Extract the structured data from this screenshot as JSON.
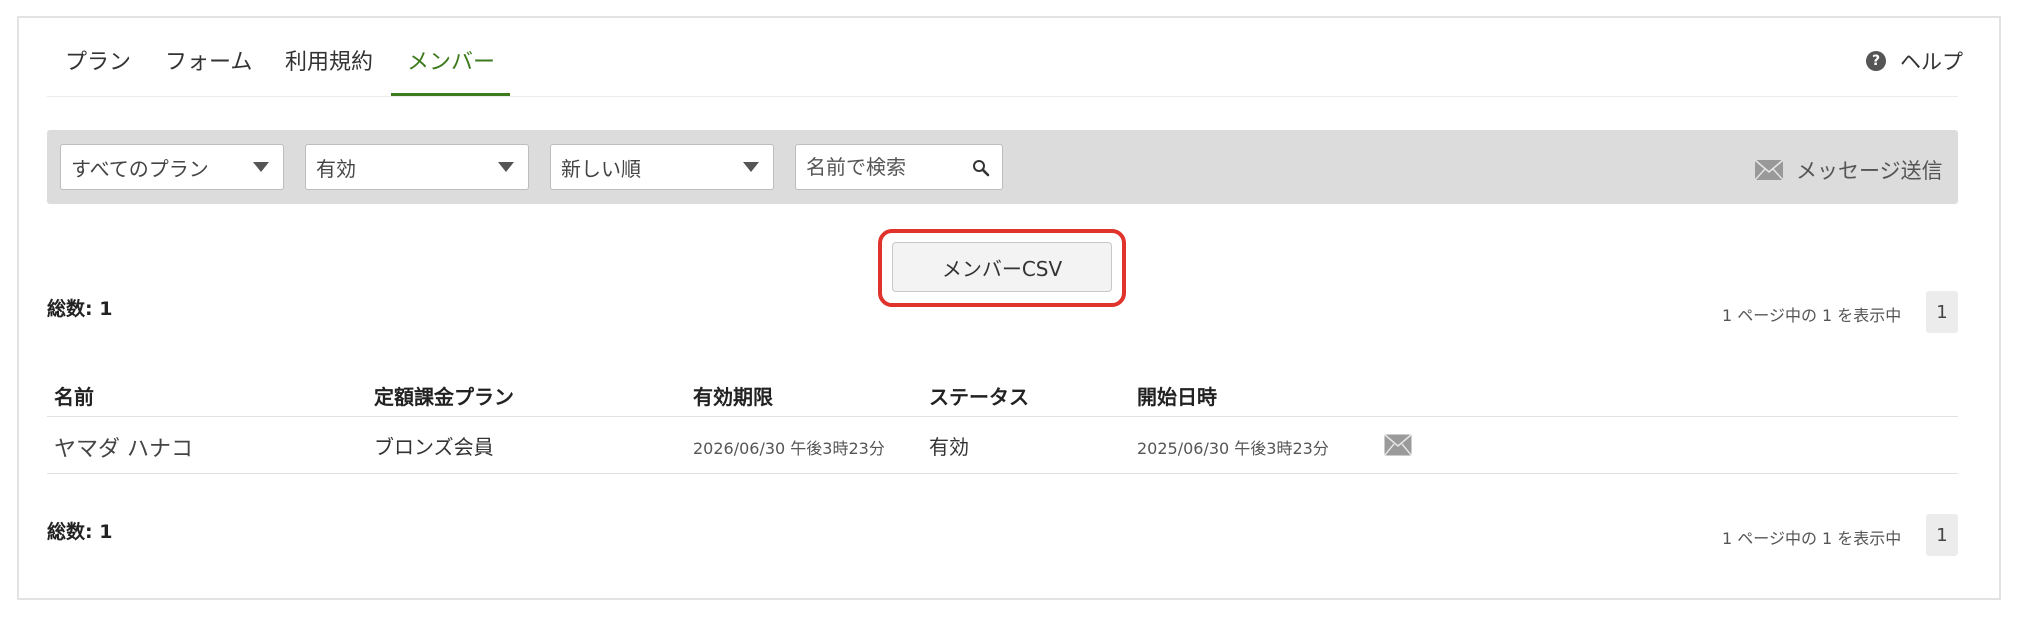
{
  "tabs": [
    {
      "label": "プラン",
      "active": false
    },
    {
      "label": "フォーム",
      "active": false
    },
    {
      "label": "利用規約",
      "active": false
    },
    {
      "label": "メンバー",
      "active": true
    }
  ],
  "help": {
    "label": "ヘルプ",
    "icon": "question-circle-icon"
  },
  "filters": {
    "plan_select": "すべてのプラン",
    "status_select": "有効",
    "sort_select": "新しい順",
    "search_placeholder": "名前で検索",
    "send_message_label": "メッセージ送信"
  },
  "csv_button_label": "メンバーCSV",
  "summary_top": {
    "total_label": "総数: 1",
    "page_info": "1 ページ中の 1 を表示中",
    "page_number": "1"
  },
  "table": {
    "headers": [
      "名前",
      "定額課金プラン",
      "有効期限",
      "ステータス",
      "開始日時"
    ],
    "rows": [
      {
        "name": "ヤマダ ハナコ",
        "plan": "ブロンズ会員",
        "expiry": "2026/06/30 午後3時23分",
        "status": "有効",
        "start": "2025/06/30 午後3時23分"
      }
    ]
  },
  "summary_bottom": {
    "total_label": "総数: 1",
    "page_info": "1 ページ中の 1 を表示中",
    "page_number": "1"
  },
  "colors": {
    "accent": "#3d7a1c",
    "highlight": "#e0332b",
    "filter_bar": "#dcdcdc"
  }
}
